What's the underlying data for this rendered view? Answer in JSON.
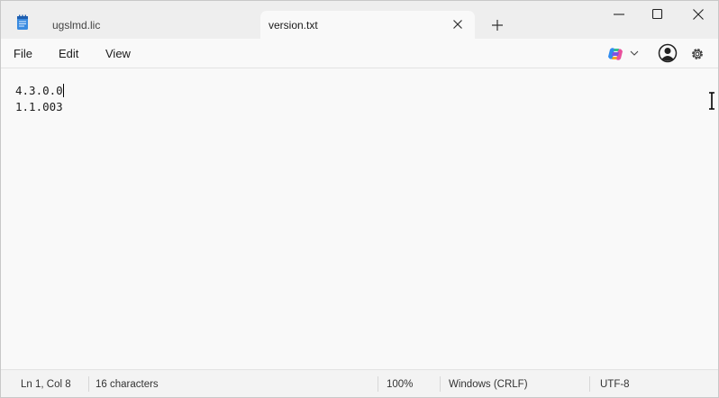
{
  "tabs": [
    {
      "label": "ugslmd.lic",
      "active": false
    },
    {
      "label": "version.txt",
      "active": true
    }
  ],
  "menu": {
    "file": "File",
    "edit": "Edit",
    "view": "View"
  },
  "editor": {
    "lines": [
      "4.3.0.0",
      "1.1.003"
    ]
  },
  "status": {
    "position": "Ln 1, Col 8",
    "characters": "16 characters",
    "zoom": "100%",
    "line_ending": "Windows (CRLF)",
    "encoding": "UTF-8"
  },
  "icons": {
    "app": "notepad-icon",
    "new_tab": "plus-icon",
    "copilot": "copilot-icon",
    "account": "account-icon",
    "settings": "gear-icon"
  },
  "colors": {
    "accent": "#2f6fd8"
  }
}
